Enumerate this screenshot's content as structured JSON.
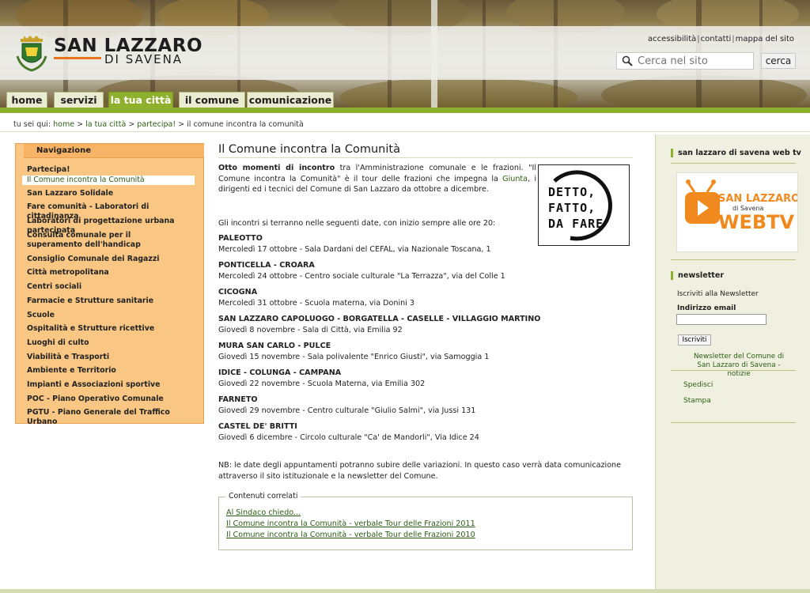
{
  "site": {
    "name": "SAN LAZZARO",
    "subname": "DI SAVENA"
  },
  "utility_links": [
    "accessibilità",
    "contatti",
    "mappa del sito"
  ],
  "search": {
    "placeholder": "Cerca nel sito",
    "button_label": "cerca"
  },
  "tabs": [
    {
      "label": "home",
      "active": false
    },
    {
      "label": "servizi",
      "active": false
    },
    {
      "label": "la tua città",
      "active": true
    },
    {
      "label": "il comune",
      "active": false
    },
    {
      "label": "comunicazione",
      "active": false
    }
  ],
  "breadcrumb": {
    "prefix": "tu sei qui:",
    "items": [
      "home",
      "la tua città",
      "partecipa!",
      "il comune incontra la comunità"
    ]
  },
  "navigation": {
    "heading": "Navigazione",
    "items": [
      "Partecipa!",
      "Il Comune incontra la Comunità",
      "San Lazzaro Solidale",
      "Fare comunità - Laboratori di cittadinanza",
      "Laboratori di progettazione urbana partecipata",
      "Consulta comunale per il superamento dell'handicap",
      "Consiglio Comunale dei Ragazzi",
      "Città metropolitana",
      "Centri sociali",
      "Farmacie e Strutture sanitarie",
      "Scuole",
      "Ospitalità e Strutture ricettive",
      "Luoghi di culto",
      "Viabilità e Trasporti",
      "Ambiente e Territorio",
      "Impianti e Associazioni sportive",
      "POC - Piano Operativo Comunale",
      "PGTU - Piano Generale del Traffico Urbano"
    ],
    "current_index": 1
  },
  "main": {
    "title": "Il Comune incontra la Comunità",
    "intro_bold": "Otto momenti di incontro",
    "intro_part1": " tra l'Amministrazione comunale e le frazioni. \"Il Comune incontra la Comunità\" è il tour delle frazioni che impegna la ",
    "intro_link": "Giunta",
    "intro_part2": ", i dirigenti ed i tecnici del Comune di San Lazzaro da ottobre a dicembre.",
    "promo_text": [
      "DETTO,",
      "FATTO,",
      "DA FARE"
    ],
    "dates_intro": "Gli incontri si terranno nelle seguenti date, con inizio sempre alle ore 20:",
    "locations": [
      {
        "name": "PALEOTTO",
        "detail": "Mercoledì 17 ottobre - Sala Dardani del CEFAL, via Nazionale Toscana, 1"
      },
      {
        "name": "PONTICELLA - CROARA",
        "detail": "Mercoledì 24 ottobre - Centro sociale culturale \"La Terrazza\", via del Colle 1"
      },
      {
        "name": "CICOGNA",
        "detail": "Mercoledì 31 ottobre - Scuola materna, via Donini 3"
      },
      {
        "name": "SAN LAZZARO CAPOLUOGO - BORGATELLA - CASELLE - VILLAGGIO MARTINO",
        "detail": "Giovedì 8 novembre - Sala di Città, via Emilia 92"
      },
      {
        "name": "MURA SAN CARLO - PULCE",
        "detail": "Giovedì 15 novembre - Sala polivalente \"Enrico Giusti\", via Samoggia 1"
      },
      {
        "name": "IDICE - COLUNGA - CAMPANA",
        "detail": "Giovedì 22 novembre - Scuola Materna, via Emilia 302"
      },
      {
        "name": "FARNETO",
        "detail": "Giovedì 29 novembre - Centro culturale \"Giulio Salmi\", via Jussi 131"
      },
      {
        "name": "CASTEL DE' BRITTI",
        "detail": "Giovedì 6 dicembre - Circolo culturale \"Ca' de Mandorli\", Via Idice 24"
      }
    ],
    "note": "NB: le date degli appuntamenti potranno subire delle variazioni. In questo caso verrà data comunicazione attraverso il sito istituzionale e la newsletter del Comune.",
    "related": {
      "legend": "Contenuti correlati",
      "links": [
        "Al Sindaco chiedo...",
        "Il Comune incontra la Comunità - verbale Tour delle Frazioni 2011",
        "Il Comune incontra la Comunità - verbale Tour delle Frazioni 2010"
      ]
    }
  },
  "right": {
    "webtv_heading": "san lazzaro di savena web tv",
    "webtv_logo_line1": "SAN LAZZARO",
    "webtv_logo_line2": "di Savena",
    "webtv_logo_line3": "WEBTV",
    "newsletter_heading": "newsletter",
    "newsletter_sub": "Iscriviti alla Newsletter",
    "email_label": "Indirizzo email",
    "subscribe_label": "Iscriviti",
    "newsletter_link": "Newsletter del Comune di San Lazzaro di Savena - notizie",
    "actions": [
      "Spedisci",
      "Stampa"
    ]
  },
  "colors": {
    "accent_green": "#8fb02d",
    "nav_orange": "#f9c783",
    "link_green": "#2a5d12"
  }
}
